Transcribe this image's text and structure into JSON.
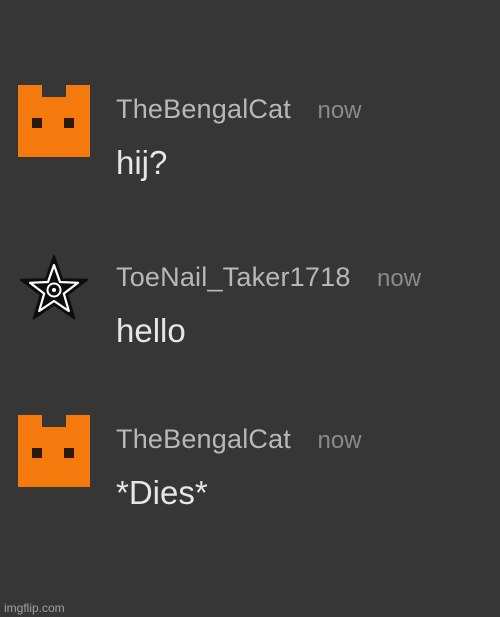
{
  "messages": [
    {
      "username": "TheBengalCat",
      "timestamp": "now",
      "text": "hij?",
      "avatar_icon": "orange-cat-block-icon",
      "avatar_color": "#f47a0d"
    },
    {
      "username": "ToeNail_Taker1718",
      "timestamp": "now",
      "text": "hello",
      "avatar_icon": "star-icon",
      "avatar_color": "#ffffff"
    },
    {
      "username": "TheBengalCat",
      "timestamp": "now",
      "text": "*Dies*",
      "avatar_icon": "orange-cat-block-icon",
      "avatar_color": "#f47a0d"
    }
  ],
  "watermark": "imgflip.com",
  "colors": {
    "background": "#363636",
    "username": "#b8b8b8",
    "timestamp": "#8a8a8a",
    "message_text": "#e6e6e6",
    "cat_orange": "#f47a0d"
  }
}
